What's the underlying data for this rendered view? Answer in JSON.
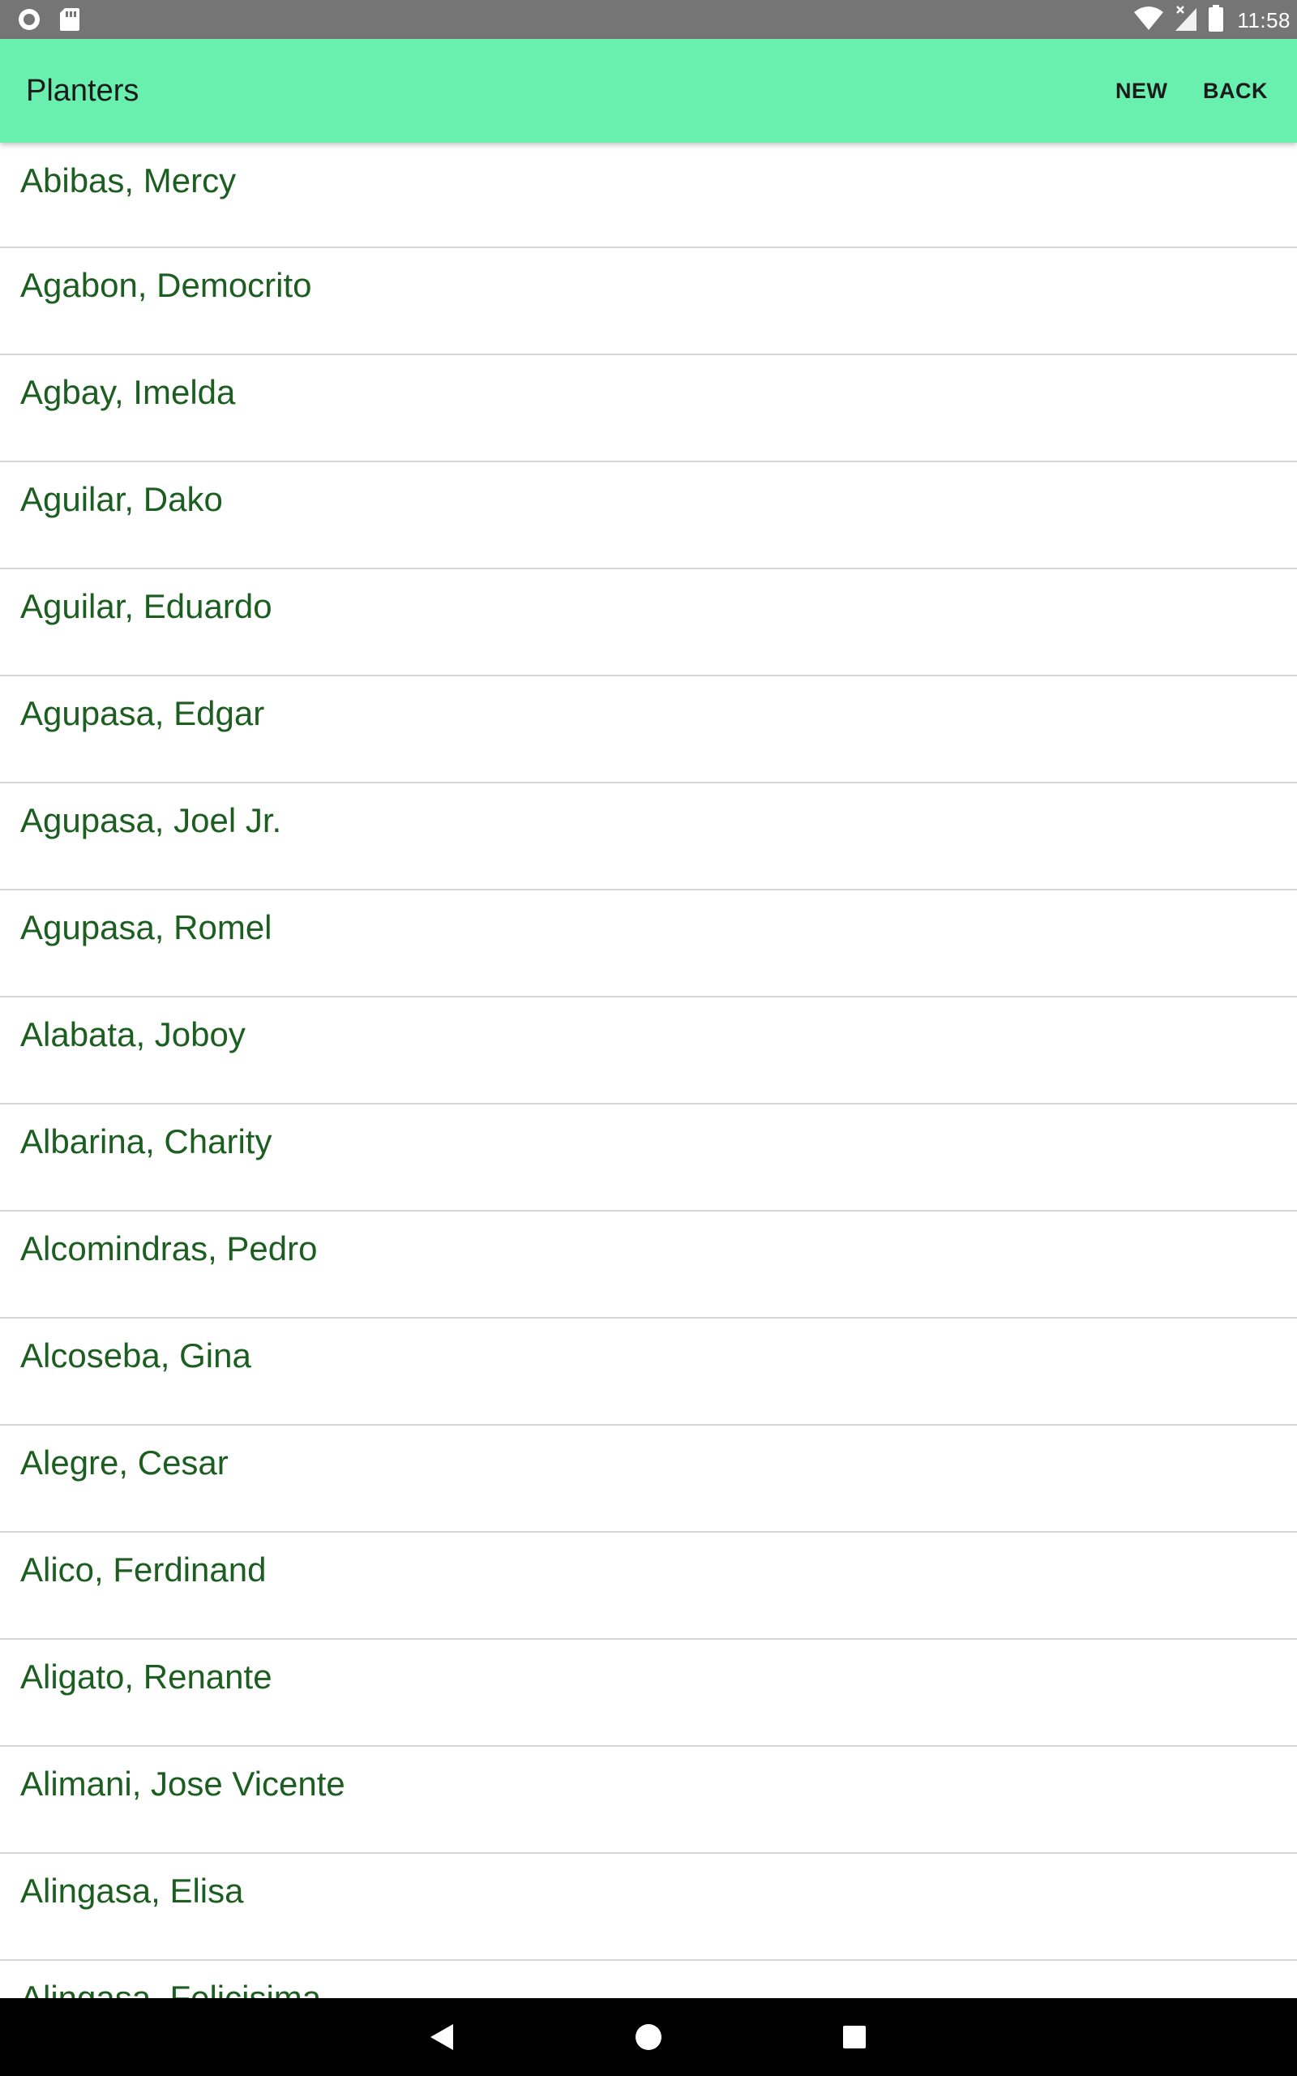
{
  "status_bar": {
    "time": "11:58",
    "icons": [
      "record-icon",
      "sd-card-icon",
      "wifi-icon",
      "no-signal-icon",
      "battery-icon"
    ]
  },
  "app_bar": {
    "title": "Planters",
    "background_color": "#69f0ae",
    "actions": {
      "new_label": "NEW",
      "back_label": "BACK"
    }
  },
  "planters": [
    "Abibas, Mercy",
    "Agabon, Democrito",
    "Agbay, Imelda",
    "Aguilar, Dako",
    "Aguilar, Eduardo",
    "Agupasa, Edgar",
    "Agupasa, Joel Jr.",
    "Agupasa, Romel",
    "Alabata, Joboy",
    "Albarina, Charity",
    "Alcomindras, Pedro",
    "Alcoseba, Gina",
    "Alegre, Cesar",
    "Alico, Ferdinand",
    "Aligato, Renante",
    "Alimani, Jose Vicente",
    "Alingasa, Elisa",
    "Alingasa, Felicisima"
  ],
  "list_text_color": "#1b5e20",
  "nav_bar": {
    "buttons": [
      "nav-back-icon",
      "nav-home-icon",
      "nav-recents-icon"
    ]
  }
}
